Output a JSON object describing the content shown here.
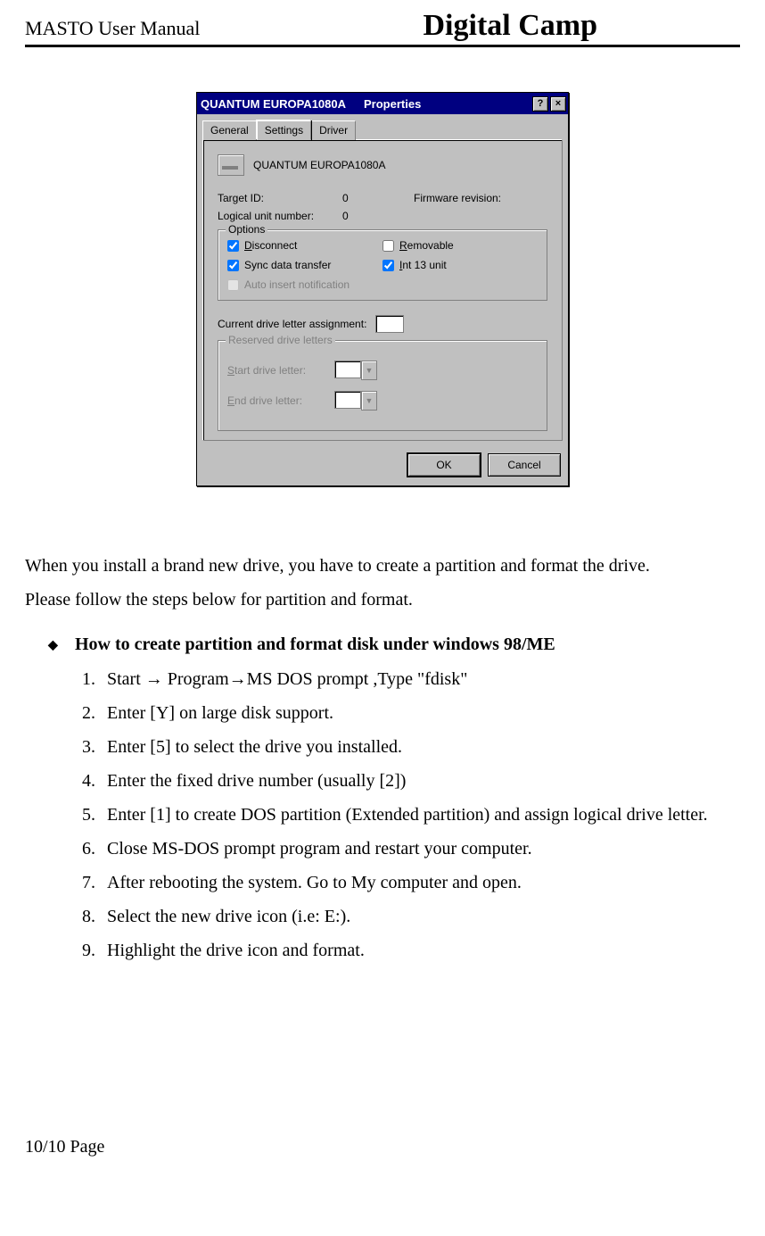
{
  "header": {
    "left": "MASTO User Manual",
    "right": "Digital Camp"
  },
  "dialog": {
    "title_device": "QUANTUM EUROPA1080A",
    "title_suffix": "Properties",
    "help_btn": "?",
    "close_btn": "×",
    "tabs": {
      "general": "General",
      "settings": "Settings",
      "driver": "Driver"
    },
    "device_name": "QUANTUM EUROPA1080A",
    "target_id_label": "Target ID:",
    "target_id_value": "0",
    "lun_label": "Logical unit number:",
    "lun_value": "0",
    "firmware_label": "Firmware revision:",
    "options_legend": "Options",
    "opt_disconnect": "Disconnect",
    "opt_sync": "Sync data transfer",
    "opt_auto": "Auto insert notification",
    "opt_removable": "Removable",
    "opt_int13": "Int 13 unit",
    "cur_drive_label": "Current drive letter assignment:",
    "reserved_legend": "Reserved drive letters",
    "start_letter_label": "Start drive letter:",
    "end_letter_label": "End drive letter:",
    "ok": "OK",
    "cancel": "Cancel"
  },
  "para1": "When you install a brand new drive, you have to create a partition and format the drive.",
  "para2": "Please follow the steps below for partition and format.",
  "section_title": "How to create partition and format disk under windows 98/ME",
  "steps": [
    "Start → Program→MS DOS prompt ,Type \"fdisk\"",
    "Enter [Y] on large disk support.",
    "Enter [5] to select the drive you installed.",
    "Enter the fixed drive number (usually [2])",
    "Enter [1] to create DOS partition (Extended partition) and assign logical drive letter.",
    "Close MS-DOS prompt program and restart your computer.",
    "After rebooting the system. Go to My computer and open.",
    "Select the new drive icon (i.e: E:).",
    "Highlight the drive icon and format."
  ],
  "footer": "10/10 Page"
}
